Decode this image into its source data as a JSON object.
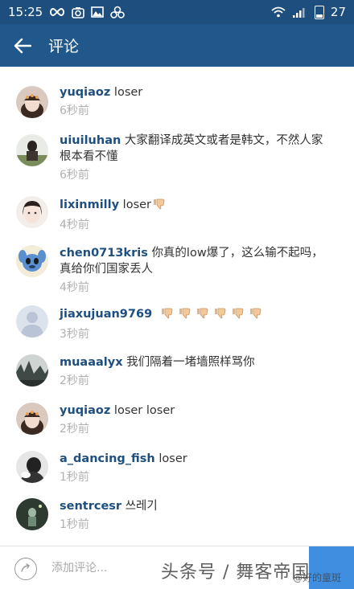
{
  "status_bar": {
    "time": "15:25",
    "battery": "27",
    "icons": [
      "infinity-icon",
      "camera-app-icon",
      "gallery-icon",
      "link-icon",
      "wifi-icon",
      "signal-icon",
      "battery-icon"
    ]
  },
  "app_bar": {
    "title": "评论"
  },
  "partial_time": "",
  "comments": [
    {
      "user": "yuqiaoz",
      "text": "loser",
      "time": "6秒前"
    },
    {
      "user": "uiuiluhan",
      "text": "大家翻译成英文或者是韩文，不然人家根本看不懂",
      "time": "6秒前"
    },
    {
      "user": "lixinmilly",
      "text": "loser",
      "time": "4秒前"
    },
    {
      "user": "chen0713kris",
      "text": "你真的low爆了，这么输不起吗，真给你们国家丢人",
      "time": "4秒前"
    },
    {
      "user": "jiaxujuan9769",
      "text": "",
      "time": "3秒前"
    },
    {
      "user": "muaaalyx",
      "text": "我们隔着一堵墙照样骂你",
      "time": "2秒前"
    },
    {
      "user": "yuqiaoz",
      "text": "loser loser",
      "time": "2秒前"
    },
    {
      "user": "a_dancing_fish",
      "text": "loser",
      "time": "1秒前"
    },
    {
      "user": "sentrcesr",
      "text": "쓰레기",
      "time": "1秒前"
    }
  ],
  "input": {
    "placeholder": "添加评论..."
  },
  "watermark": {
    "main": "头条号 / 舞客帝国",
    "small": "@好的童斑"
  },
  "colors": {
    "status_bar": "#1d4e7e",
    "app_bar": "#21588c",
    "username": "#1e4f80",
    "send_button": "#3f8ee0"
  }
}
